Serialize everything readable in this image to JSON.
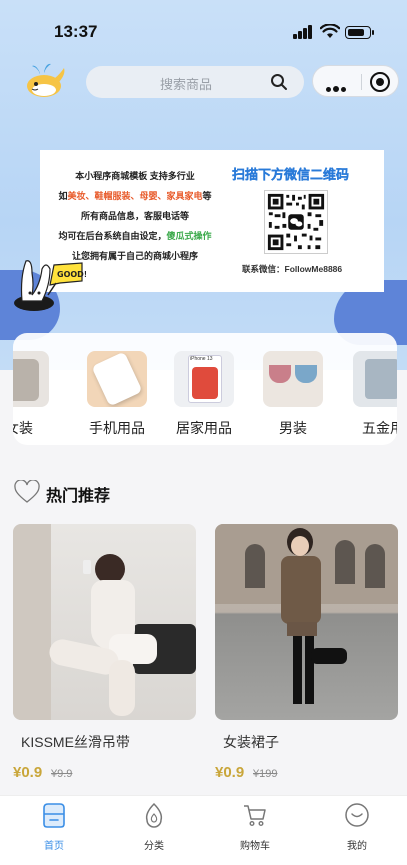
{
  "status": {
    "time": "13:37",
    "battery_level": 0.8
  },
  "search": {
    "placeholder": "搜索商品"
  },
  "banner": {
    "line1": "本小程序商城模板 支持多行业",
    "line2_prefix": "如",
    "line2_highlight": "美妆、鞋帽服装、母婴、家具家电",
    "line2_suffix": "等",
    "line3": "所有商品信息，客服电话等",
    "line4_prefix": "均可在后台系统自由设定，",
    "line4_highlight": "傻瓜式操作",
    "line5": "让您拥有属于自己的商城小程序",
    "qr_title": "扫描下方微信二维码",
    "contact": "联系微信：FollowMe8886",
    "mascot_text": "GOOD!"
  },
  "categories": [
    {
      "label": "女装",
      "icon": "clothes-image"
    },
    {
      "label": "手机用品",
      "icon": "phone-case-image"
    },
    {
      "label": "居家用品",
      "icon": "iphone-box-image"
    },
    {
      "label": "男装",
      "icon": "underwear-image"
    },
    {
      "label": "五金用",
      "icon": "tools-image"
    }
  ],
  "category_badge": "iPhone 13",
  "section": {
    "title": "热门推荐"
  },
  "products": [
    {
      "title": "KISSME丝滑吊带",
      "price": "¥0.9",
      "old_price": "¥9.9"
    },
    {
      "title": "女装裙子",
      "price": "¥0.9",
      "old_price": "¥199"
    }
  ],
  "tabbar": [
    {
      "label": "首页",
      "icon": "home-icon",
      "active": true
    },
    {
      "label": "分类",
      "icon": "category-icon",
      "active": false
    },
    {
      "label": "购物车",
      "icon": "cart-icon",
      "active": false
    },
    {
      "label": "我的",
      "icon": "profile-icon",
      "active": false
    }
  ],
  "colors": {
    "accent": "#3a8ee6",
    "price": "#c9a63a",
    "hero": "#b7d5f5",
    "blob": "#5e84d8"
  }
}
